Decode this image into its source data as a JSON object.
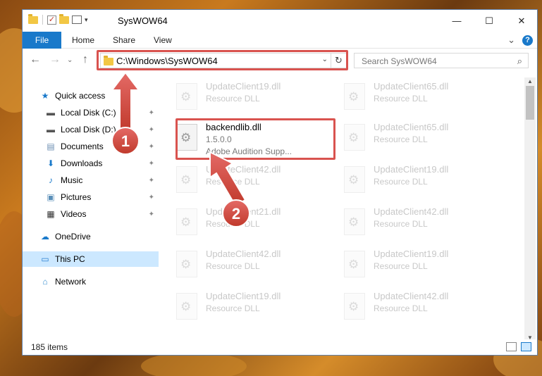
{
  "window": {
    "title": "SysWOW64",
    "minimize": "—",
    "maximize": "☐",
    "close": "✕"
  },
  "ribbon": {
    "file": "File",
    "home": "Home",
    "share": "Share",
    "view": "View",
    "expand": "⌄",
    "help": "?"
  },
  "nav": {
    "back": "←",
    "forward": "→",
    "recent": "⌄",
    "up": "↑",
    "address": "C:\\Windows\\SysWOW64",
    "address_drop": "⌄",
    "refresh": "↻",
    "search_placeholder": "Search SysWOW64",
    "search_icon": "⌕"
  },
  "sidebar": {
    "items": [
      {
        "label": "Quick access",
        "icon": "★",
        "icon_name": "quick-access-star-icon",
        "pinned": false
      },
      {
        "label": "Local Disk (C:)",
        "icon": "▬",
        "icon_name": "drive-icon",
        "pinned": true
      },
      {
        "label": "Local Disk (D:)",
        "icon": "▬",
        "icon_name": "drive-icon",
        "pinned": true
      },
      {
        "label": "Documents",
        "icon": "▤",
        "icon_name": "documents-icon",
        "pinned": true
      },
      {
        "label": "Downloads",
        "icon": "⬇",
        "icon_name": "downloads-icon",
        "pinned": true
      },
      {
        "label": "Music",
        "icon": "♪",
        "icon_name": "music-icon",
        "pinned": true
      },
      {
        "label": "Pictures",
        "icon": "▣",
        "icon_name": "pictures-icon",
        "pinned": true
      },
      {
        "label": "Videos",
        "icon": "▦",
        "icon_name": "videos-icon",
        "pinned": true
      },
      {
        "label": "OneDrive",
        "icon": "☁",
        "icon_name": "onedrive-cloud-icon",
        "pinned": false
      },
      {
        "label": "This PC",
        "icon": "▭",
        "icon_name": "this-pc-monitor-icon",
        "pinned": false
      },
      {
        "label": "Network",
        "icon": "⌂",
        "icon_name": "network-icon",
        "pinned": false
      }
    ],
    "pin_glyph": "📌"
  },
  "files": [
    {
      "name": "UpdateClient19.dll",
      "desc": "Resource DLL",
      "faded": true
    },
    {
      "name": "UpdateClient65.dll",
      "desc": "Resource DLL",
      "faded": true
    },
    {
      "name": "backendlib.dll",
      "desc": "1.5.0.0",
      "desc2": "Adobe Audition Supp...",
      "faded": false
    },
    {
      "name": "UpdateClient65.dll",
      "desc": "Resource DLL",
      "faded": true
    },
    {
      "name": "UpdateClient42.dll",
      "desc": "Resource DLL",
      "faded": true
    },
    {
      "name": "UpdateClient19.dll",
      "desc": "Resource DLL",
      "faded": true
    },
    {
      "name": "UpdateClient21.dll",
      "desc": "Resource DLL",
      "faded": true
    },
    {
      "name": "UpdateClient42.dll",
      "desc": "Resource DLL",
      "faded": true
    },
    {
      "name": "UpdateClient42.dll",
      "desc": "Resource DLL",
      "faded": true
    },
    {
      "name": "UpdateClient19.dll",
      "desc": "Resource DLL",
      "faded": true
    },
    {
      "name": "UpdateClient19.dll",
      "desc": "Resource DLL",
      "faded": true
    },
    {
      "name": "UpdateClient42.dll",
      "desc": "Resource DLL",
      "faded": true
    }
  ],
  "status": {
    "count": "185 items"
  },
  "annotations": {
    "step1": "1",
    "step2": "2",
    "color": "#d9534f"
  },
  "colors": {
    "accent": "#1979ca",
    "selection": "#cce8ff",
    "highlight": "#d9534f"
  }
}
